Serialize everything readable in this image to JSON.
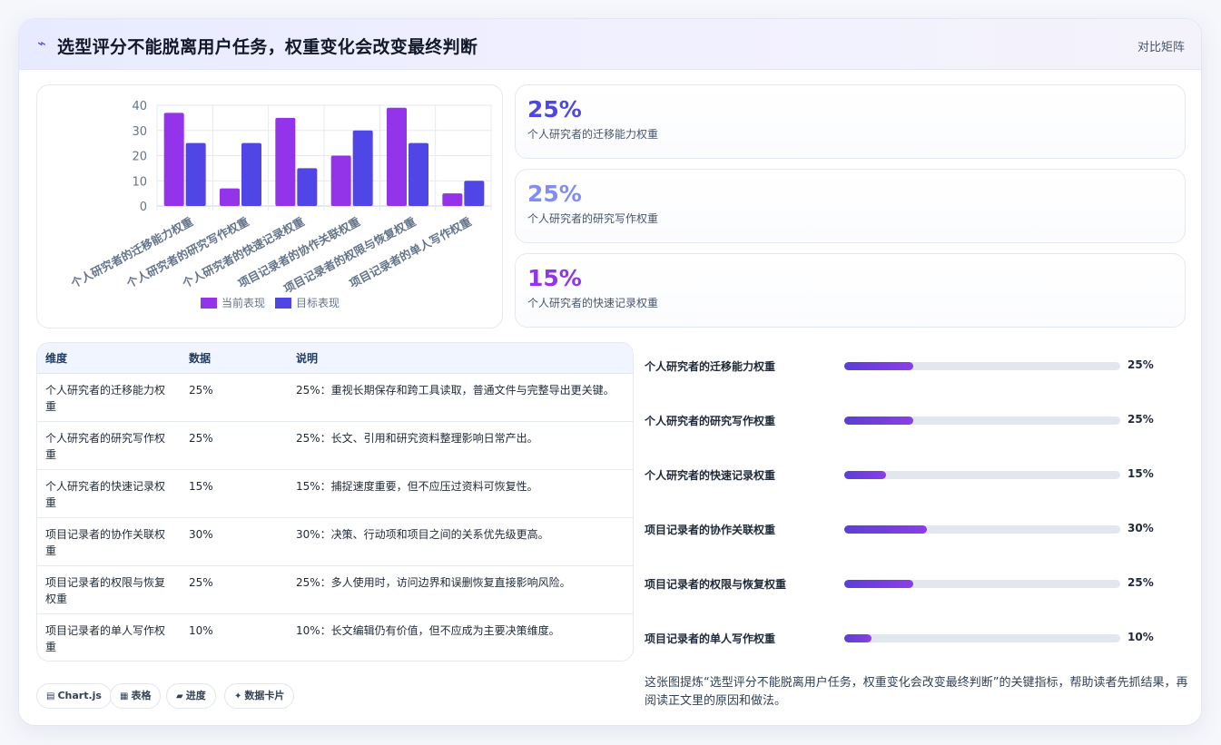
{
  "header": {
    "logo": "⌁",
    "title": "选型评分不能脱离用户任务，权重变化会改变最终判断",
    "tag": "对比矩阵"
  },
  "stats": [
    {
      "value": "25%",
      "label": "个人研究者的迁移能力权重",
      "color": "#4f46e5"
    },
    {
      "value": "25%",
      "label": "个人研究者的研究写作权重",
      "color": "#818cf8"
    },
    {
      "value": "15%",
      "label": "个人研究者的快速记录权重",
      "color": "#9333ea"
    }
  ],
  "chart_data": {
    "type": "bar",
    "categories": [
      "个人研究者的迁移能力权重",
      "个人研究者的研究写作权重",
      "个人研究者的快速记录权重",
      "项目记录者的协作关联权重",
      "项目记录者的权限与恢复权重",
      "项目记录者的单人写作权重"
    ],
    "series": [
      {
        "name": "当前表现",
        "values": [
          37,
          7,
          35,
          20,
          39,
          5
        ],
        "color": "#9333ea"
      },
      {
        "name": "目标表现",
        "values": [
          25,
          25,
          15,
          30,
          25,
          10
        ],
        "color": "#4f46e5"
      }
    ],
    "yticks": [
      "0",
      "10",
      "20",
      "30",
      "40"
    ],
    "ylim": [
      0,
      40
    ],
    "grid": true,
    "legend": "bottom"
  },
  "table": {
    "headers": [
      "维度",
      "数据",
      "说明"
    ],
    "rows": [
      [
        "个人研究者的迁移能力权重",
        "25%",
        "25%：重视长期保存和跨工具读取，普通文件与完整导出更关键。"
      ],
      [
        "个人研究者的研究写作权重",
        "25%",
        "25%：长文、引用和研究资料整理影响日常产出。"
      ],
      [
        "个人研究者的快速记录权重",
        "15%",
        "15%：捕捉速度重要，但不应压过资料可恢复性。"
      ],
      [
        "项目记录者的协作关联权重",
        "30%",
        "30%：决策、行动项和项目之间的关系优先级更高。"
      ],
      [
        "项目记录者的权限与恢复权重",
        "25%",
        "25%：多人使用时，访问边界和误删恢复直接影响风险。"
      ],
      [
        "项目记录者的单人写作权重",
        "10%",
        "10%：长文编辑仍有价值，但不应成为主要决策维度。"
      ]
    ]
  },
  "progress": [
    {
      "label": "个人研究者的迁移能力权重",
      "value": 25,
      "text": "25%"
    },
    {
      "label": "个人研究者的研究写作权重",
      "value": 25,
      "text": "25%"
    },
    {
      "label": "个人研究者的快速记录权重",
      "value": 15,
      "text": "15%"
    },
    {
      "label": "项目记录者的协作关联权重",
      "value": 30,
      "text": "30%"
    },
    {
      "label": "项目记录者的权限与恢复权重",
      "value": 25,
      "text": "25%"
    },
    {
      "label": "项目记录者的单人写作权重",
      "value": 10,
      "text": "10%"
    }
  ],
  "progress_max": 100,
  "note": "这张图提炼“选型评分不能脱离用户任务，权重变化会改变最终判断”的关键指标，帮助读者先抓结果，再阅读正文里的原因和做法。",
  "chips": [
    {
      "icon": "▤",
      "label": "Chart.js"
    },
    {
      "icon": "▦",
      "label": "表格"
    },
    {
      "icon": "▰",
      "label": "进度"
    },
    {
      "icon": "✦",
      "label": "数据卡片"
    }
  ]
}
